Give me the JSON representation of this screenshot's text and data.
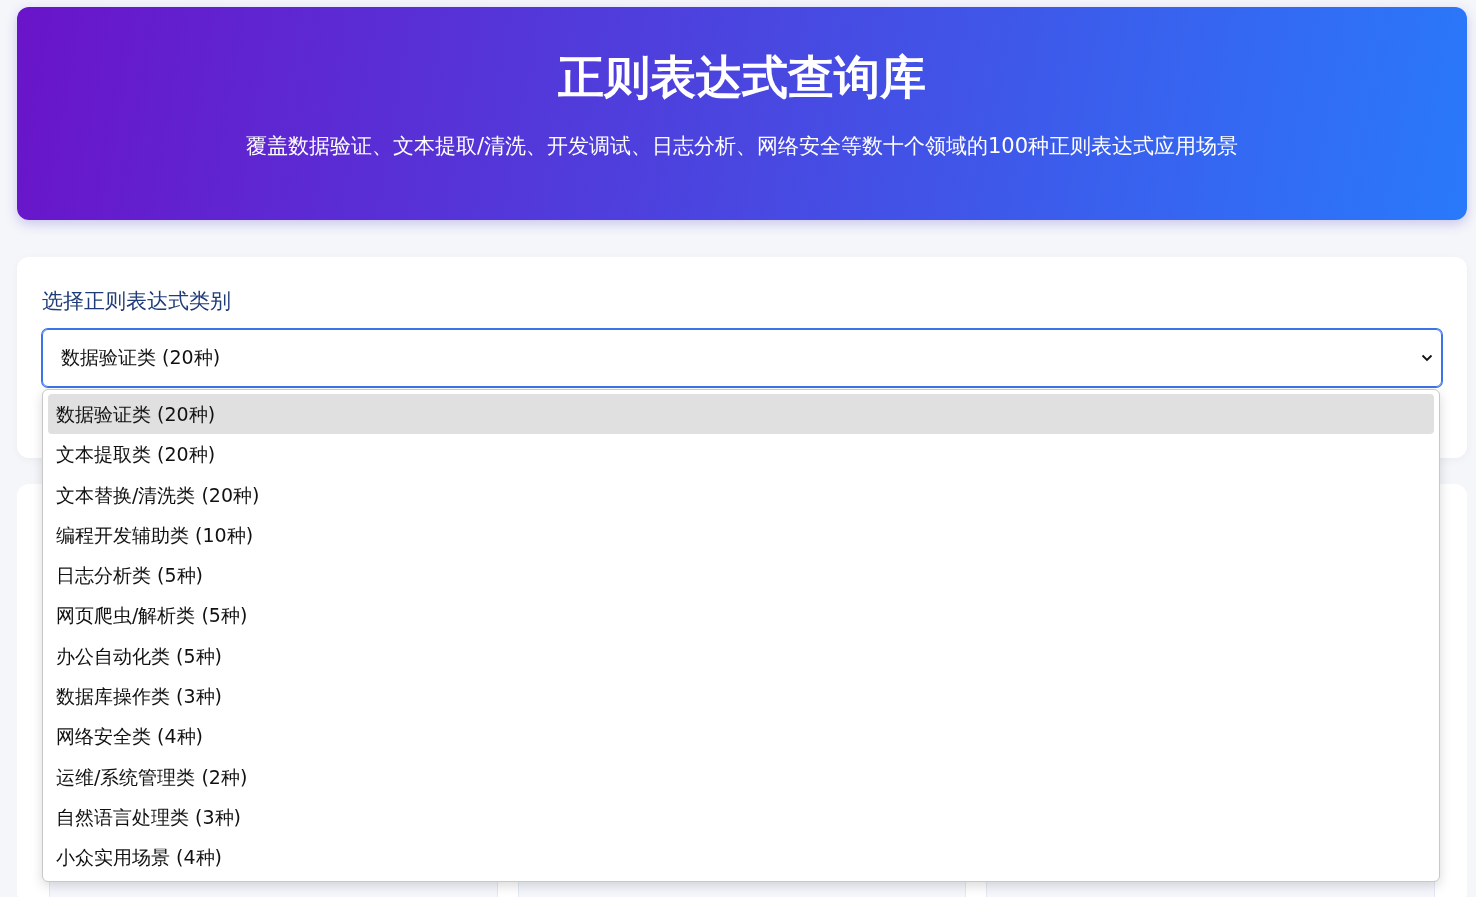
{
  "header": {
    "title": "正则表达式查询库",
    "subtitle": "覆盖数据验证、文本提取/清洗、开发调试、日志分析、网络安全等数十个领域的100种正则表达式应用场景"
  },
  "category": {
    "label": "选择正则表达式类别",
    "value": "数据验证类 (20种)",
    "expanded": true,
    "options": [
      {
        "label": "数据验证类 (20种)",
        "selected": true
      },
      {
        "label": "文本提取类 (20种)",
        "selected": false
      },
      {
        "label": "文本替换/清洗类 (20种)",
        "selected": false
      },
      {
        "label": "编程开发辅助类 (10种)",
        "selected": false
      },
      {
        "label": "日志分析类 (5种)",
        "selected": false
      },
      {
        "label": "网页爬虫/解析类 (5种)",
        "selected": false
      },
      {
        "label": "办公自动化类 (5种)",
        "selected": false
      },
      {
        "label": "数据库操作类 (3种)",
        "selected": false
      },
      {
        "label": "网络安全类 (4种)",
        "selected": false
      },
      {
        "label": "运维/系统管理类 (2种)",
        "selected": false
      },
      {
        "label": "自然语言处理类 (3种)",
        "selected": false
      },
      {
        "label": "小众实用场景 (4种)",
        "selected": false
      }
    ]
  }
}
